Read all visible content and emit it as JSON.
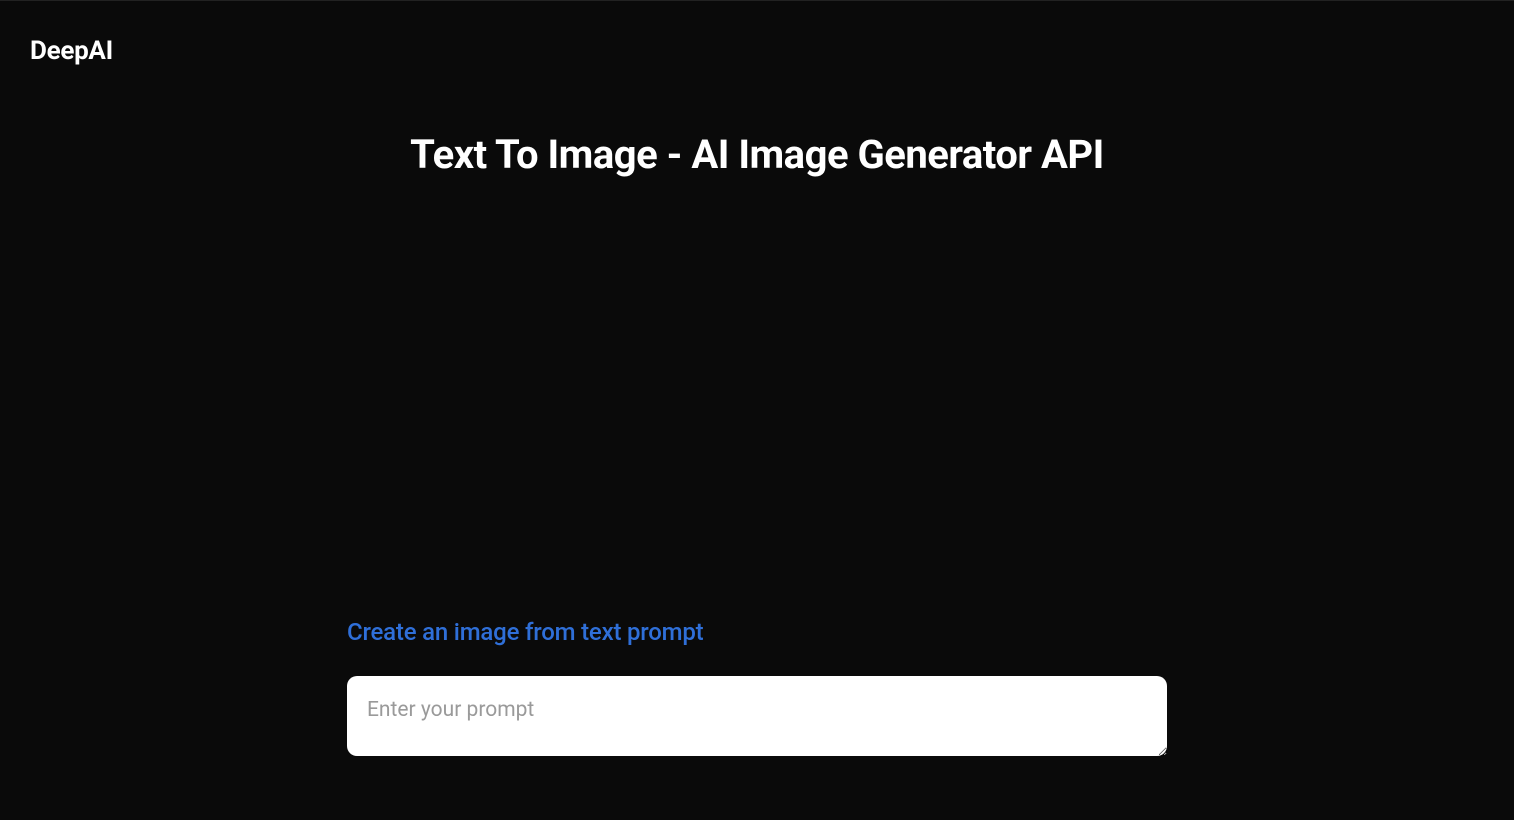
{
  "header": {
    "logo": "DeepAI"
  },
  "main": {
    "title": "Text To Image - AI Image Generator API",
    "subtitle": "Create an image from text prompt",
    "prompt_placeholder": "Enter your prompt",
    "prompt_value": ""
  },
  "colors": {
    "background": "#0a0a0a",
    "text": "#ffffff",
    "link": "#2f6fd8",
    "input_background": "#ffffff",
    "placeholder": "#9a9a9a"
  }
}
